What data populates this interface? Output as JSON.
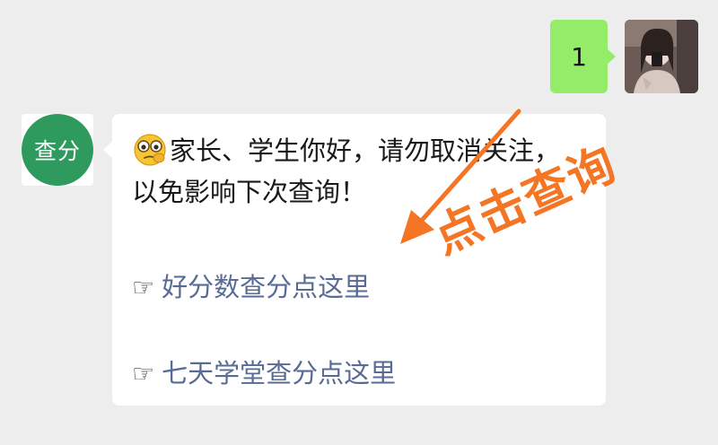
{
  "outgoing": {
    "text": "1",
    "bubble_color": "#95ec69"
  },
  "incoming": {
    "avatar_label": "查分",
    "avatar_color": "#2e9a5e",
    "emoji": "face-with-monocle-emoji",
    "text_line1": "家长、学生你好，请勿取消关注，",
    "text_line2": "以免影响下次查询！",
    "links": [
      {
        "icon": "☞",
        "label": "好分数查分点这里"
      },
      {
        "icon": "☞",
        "label": "七天学堂查分点这里"
      }
    ],
    "link_color": "#576b95"
  },
  "annotation": {
    "text": "点击查询",
    "color": "#f47524"
  }
}
